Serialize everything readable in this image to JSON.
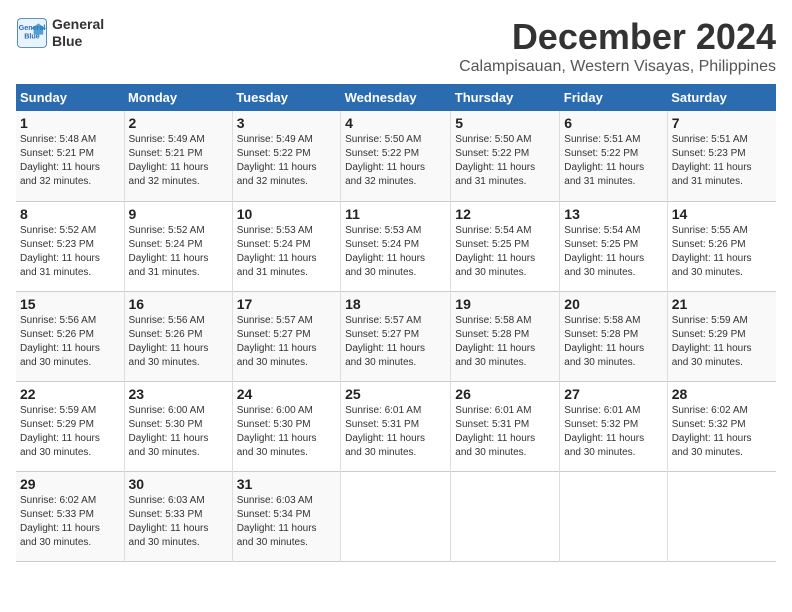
{
  "header": {
    "logo_line1": "General",
    "logo_line2": "Blue",
    "title": "December 2024",
    "subtitle": "Calampisauan, Western Visayas, Philippines"
  },
  "days_of_week": [
    "Sunday",
    "Monday",
    "Tuesday",
    "Wednesday",
    "Thursday",
    "Friday",
    "Saturday"
  ],
  "weeks": [
    [
      {
        "day": "1",
        "info": "Sunrise: 5:48 AM\nSunset: 5:21 PM\nDaylight: 11 hours\nand 32 minutes."
      },
      {
        "day": "2",
        "info": "Sunrise: 5:49 AM\nSunset: 5:21 PM\nDaylight: 11 hours\nand 32 minutes."
      },
      {
        "day": "3",
        "info": "Sunrise: 5:49 AM\nSunset: 5:22 PM\nDaylight: 11 hours\nand 32 minutes."
      },
      {
        "day": "4",
        "info": "Sunrise: 5:50 AM\nSunset: 5:22 PM\nDaylight: 11 hours\nand 32 minutes."
      },
      {
        "day": "5",
        "info": "Sunrise: 5:50 AM\nSunset: 5:22 PM\nDaylight: 11 hours\nand 31 minutes."
      },
      {
        "day": "6",
        "info": "Sunrise: 5:51 AM\nSunset: 5:22 PM\nDaylight: 11 hours\nand 31 minutes."
      },
      {
        "day": "7",
        "info": "Sunrise: 5:51 AM\nSunset: 5:23 PM\nDaylight: 11 hours\nand 31 minutes."
      }
    ],
    [
      {
        "day": "8",
        "info": "Sunrise: 5:52 AM\nSunset: 5:23 PM\nDaylight: 11 hours\nand 31 minutes."
      },
      {
        "day": "9",
        "info": "Sunrise: 5:52 AM\nSunset: 5:24 PM\nDaylight: 11 hours\nand 31 minutes."
      },
      {
        "day": "10",
        "info": "Sunrise: 5:53 AM\nSunset: 5:24 PM\nDaylight: 11 hours\nand 31 minutes."
      },
      {
        "day": "11",
        "info": "Sunrise: 5:53 AM\nSunset: 5:24 PM\nDaylight: 11 hours\nand 30 minutes."
      },
      {
        "day": "12",
        "info": "Sunrise: 5:54 AM\nSunset: 5:25 PM\nDaylight: 11 hours\nand 30 minutes."
      },
      {
        "day": "13",
        "info": "Sunrise: 5:54 AM\nSunset: 5:25 PM\nDaylight: 11 hours\nand 30 minutes."
      },
      {
        "day": "14",
        "info": "Sunrise: 5:55 AM\nSunset: 5:26 PM\nDaylight: 11 hours\nand 30 minutes."
      }
    ],
    [
      {
        "day": "15",
        "info": "Sunrise: 5:56 AM\nSunset: 5:26 PM\nDaylight: 11 hours\nand 30 minutes."
      },
      {
        "day": "16",
        "info": "Sunrise: 5:56 AM\nSunset: 5:26 PM\nDaylight: 11 hours\nand 30 minutes."
      },
      {
        "day": "17",
        "info": "Sunrise: 5:57 AM\nSunset: 5:27 PM\nDaylight: 11 hours\nand 30 minutes."
      },
      {
        "day": "18",
        "info": "Sunrise: 5:57 AM\nSunset: 5:27 PM\nDaylight: 11 hours\nand 30 minutes."
      },
      {
        "day": "19",
        "info": "Sunrise: 5:58 AM\nSunset: 5:28 PM\nDaylight: 11 hours\nand 30 minutes."
      },
      {
        "day": "20",
        "info": "Sunrise: 5:58 AM\nSunset: 5:28 PM\nDaylight: 11 hours\nand 30 minutes."
      },
      {
        "day": "21",
        "info": "Sunrise: 5:59 AM\nSunset: 5:29 PM\nDaylight: 11 hours\nand 30 minutes."
      }
    ],
    [
      {
        "day": "22",
        "info": "Sunrise: 5:59 AM\nSunset: 5:29 PM\nDaylight: 11 hours\nand 30 minutes."
      },
      {
        "day": "23",
        "info": "Sunrise: 6:00 AM\nSunset: 5:30 PM\nDaylight: 11 hours\nand 30 minutes."
      },
      {
        "day": "24",
        "info": "Sunrise: 6:00 AM\nSunset: 5:30 PM\nDaylight: 11 hours\nand 30 minutes."
      },
      {
        "day": "25",
        "info": "Sunrise: 6:01 AM\nSunset: 5:31 PM\nDaylight: 11 hours\nand 30 minutes."
      },
      {
        "day": "26",
        "info": "Sunrise: 6:01 AM\nSunset: 5:31 PM\nDaylight: 11 hours\nand 30 minutes."
      },
      {
        "day": "27",
        "info": "Sunrise: 6:01 AM\nSunset: 5:32 PM\nDaylight: 11 hours\nand 30 minutes."
      },
      {
        "day": "28",
        "info": "Sunrise: 6:02 AM\nSunset: 5:32 PM\nDaylight: 11 hours\nand 30 minutes."
      }
    ],
    [
      {
        "day": "29",
        "info": "Sunrise: 6:02 AM\nSunset: 5:33 PM\nDaylight: 11 hours\nand 30 minutes."
      },
      {
        "day": "30",
        "info": "Sunrise: 6:03 AM\nSunset: 5:33 PM\nDaylight: 11 hours\nand 30 minutes."
      },
      {
        "day": "31",
        "info": "Sunrise: 6:03 AM\nSunset: 5:34 PM\nDaylight: 11 hours\nand 30 minutes."
      },
      {
        "day": "",
        "info": ""
      },
      {
        "day": "",
        "info": ""
      },
      {
        "day": "",
        "info": ""
      },
      {
        "day": "",
        "info": ""
      }
    ]
  ]
}
